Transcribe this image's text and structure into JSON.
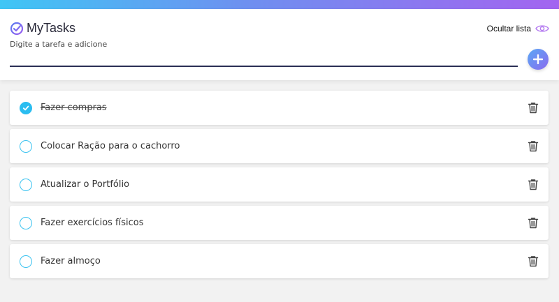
{
  "app": {
    "title": "MyTasks",
    "toggle_label": "Ocultar lista",
    "input_placeholder": "Digite a tarefa e adicione",
    "colors": {
      "accent_blue": "#2bbdf0",
      "accent_purple": "#a364f0",
      "underline": "#2b2f55"
    }
  },
  "tasks": [
    {
      "label": "Fazer compras",
      "done": true
    },
    {
      "label": "Colocar Ração para o cachorro",
      "done": false
    },
    {
      "label": "Atualizar o Portfólio",
      "done": false
    },
    {
      "label": "Fazer exercícios físicos",
      "done": false
    },
    {
      "label": "Fazer almoço",
      "done": false
    }
  ],
  "icons": {
    "logo": "check-circle-icon",
    "toggle": "eye-icon",
    "add": "plus-icon",
    "delete": "trash-icon"
  }
}
